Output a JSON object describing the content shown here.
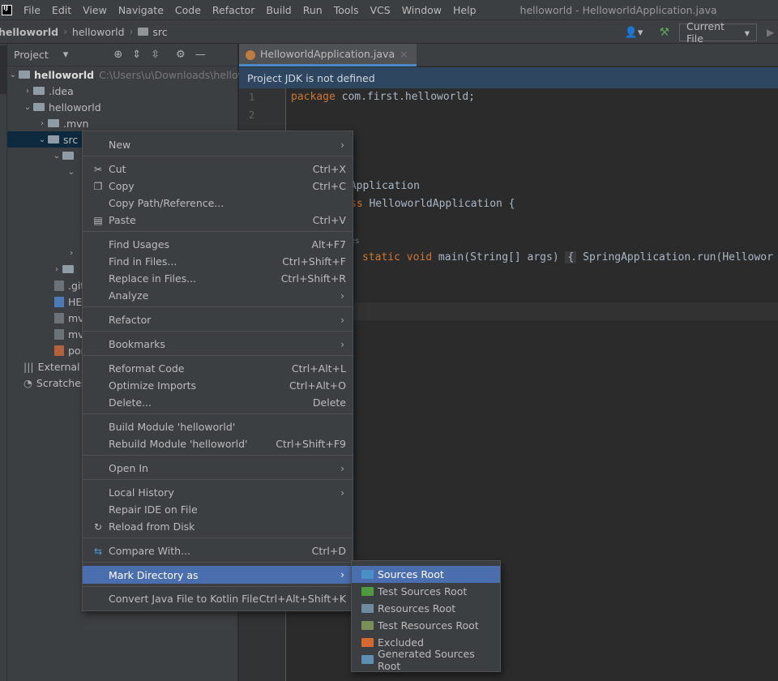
{
  "menubar": {
    "items": [
      "File",
      "Edit",
      "View",
      "Navigate",
      "Code",
      "Refactor",
      "Build",
      "Run",
      "Tools",
      "VCS",
      "Window",
      "Help"
    ],
    "window_title": "helloworld - HelloworldApplication.java"
  },
  "navbar": {
    "crumbs": [
      "helloworld",
      "helloworld",
      "src"
    ],
    "run_config": "Current File"
  },
  "project": {
    "title": "Project",
    "root_name": "helloworld",
    "root_path": "C:\\Users\\u\\Downloads\\hellow",
    "rows": {
      "idea": ".idea",
      "helloworld": "helloworld",
      "mvn": ".mvn",
      "src": "src",
      "git": ".git",
      "help": "HE",
      "mvnw": "mv",
      "mvnw_cmd": "mv",
      "pom": "por",
      "external": "External L",
      "scratches": "Scratches"
    }
  },
  "editor": {
    "tab_label": "HelloworldApplication.java",
    "jdk_banner": "Project JDK is not defined",
    "line_numbers": [
      "1",
      "2"
    ],
    "lines": {
      "l1_kw": "package",
      "l1_rest": " com.first.helloworld;",
      "l5": "tApplication",
      "l6_kw": "ss",
      "l6_rest": " HelloworldApplication {",
      "l7_hint": "es",
      "l8_kw1": "static",
      "l8_kw2": "void",
      "l8_rest": " main(String[] args) ",
      "l8_brace": "{",
      "l8_tail": " SpringApplication.run(Hellowor"
    }
  },
  "context_menu": {
    "items": [
      {
        "label": "New",
        "submenu": true
      },
      {
        "label": "Cut",
        "shortcut": "Ctrl+X",
        "icon": "scissors-icon"
      },
      {
        "label": "Copy",
        "shortcut": "Ctrl+C",
        "icon": "copy-icon"
      },
      {
        "label": "Copy Path/Reference..."
      },
      {
        "label": "Paste",
        "shortcut": "Ctrl+V",
        "icon": "paste-icon"
      },
      {
        "label": "Find Usages",
        "shortcut": "Alt+F7"
      },
      {
        "label": "Find in Files...",
        "shortcut": "Ctrl+Shift+F"
      },
      {
        "label": "Replace in Files...",
        "shortcut": "Ctrl+Shift+R"
      },
      {
        "label": "Analyze",
        "submenu": true
      },
      {
        "label": "Refactor",
        "submenu": true
      },
      {
        "label": "Bookmarks",
        "submenu": true
      },
      {
        "label": "Reformat Code",
        "shortcut": "Ctrl+Alt+L"
      },
      {
        "label": "Optimize Imports",
        "shortcut": "Ctrl+Alt+O"
      },
      {
        "label": "Delete...",
        "shortcut": "Delete"
      },
      {
        "label": "Build Module 'helloworld'"
      },
      {
        "label": "Rebuild Module 'helloworld'",
        "shortcut": "Ctrl+Shift+F9"
      },
      {
        "label": "Open In",
        "submenu": true
      },
      {
        "label": "Local History",
        "submenu": true
      },
      {
        "label": "Repair IDE on File"
      },
      {
        "label": "Reload from Disk",
        "icon": "reload-icon"
      },
      {
        "label": "Compare With...",
        "shortcut": "Ctrl+D",
        "icon": "compare-icon"
      },
      {
        "label": "Mark Directory as",
        "submenu": true,
        "active": true
      },
      {
        "label": "Convert Java File to Kotlin File",
        "shortcut": "Ctrl+Alt+Shift+K"
      }
    ]
  },
  "submenu": {
    "items": [
      {
        "label": "Sources Root",
        "color": "#4a8fc6",
        "active": true
      },
      {
        "label": "Test Sources Root",
        "color": "#4e9a3e"
      },
      {
        "label": "Resources Root",
        "color": "#6f8ba0"
      },
      {
        "label": "Test Resources Root",
        "color": "#7a8f55"
      },
      {
        "label": "Excluded",
        "color": "#d46a2f"
      },
      {
        "label": "Generated Sources Root",
        "color": "#5f8fb0"
      }
    ]
  },
  "colors": {
    "accent": "#4b6eaf",
    "banner": "#2e4660",
    "keyword": "#cc7832"
  }
}
